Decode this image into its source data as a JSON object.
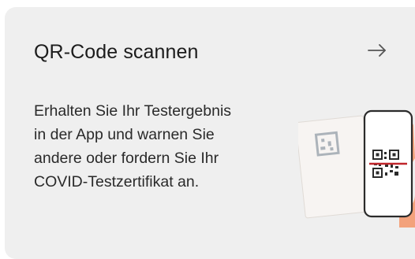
{
  "card": {
    "title": "QR-Code scannen",
    "description_lines": [
      "Erhalten Sie Ihr Testergebnis",
      "in der App und warnen Sie",
      "andere oder fordern Sie Ihr",
      "COVID-Testzertifikat an."
    ],
    "arrow_icon": "arrow-right-icon",
    "illustration_icon": "phone-scanning-qr-code-illustration"
  },
  "colors": {
    "card_background": "#efefef",
    "text": "#1c1c1c",
    "scan_line": "#c0262b",
    "phone_frame": "#2b2b2b",
    "hand": "#f3a27c"
  }
}
